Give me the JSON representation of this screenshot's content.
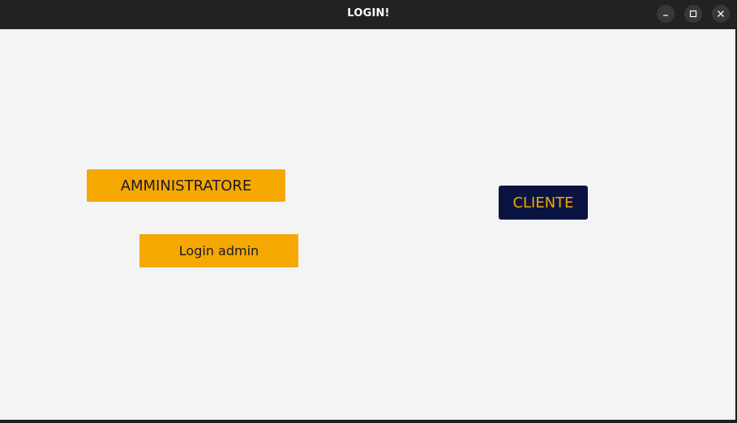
{
  "window": {
    "title": "LOGIN!"
  },
  "window_controls": {
    "minimize_icon": "minimize-icon",
    "maximize_icon": "maximize-icon",
    "close_icon": "close-icon"
  },
  "main": {
    "admin_button_label": "AMMINISTRATORE",
    "login_admin_button_label": "Login admin",
    "cliente_button_label": "CLIENTE"
  },
  "colors": {
    "titlebar_bg": "#222222",
    "content_bg": "#f4f4f4",
    "accent_yellow": "#f5a800",
    "navy": "#0b1440"
  }
}
